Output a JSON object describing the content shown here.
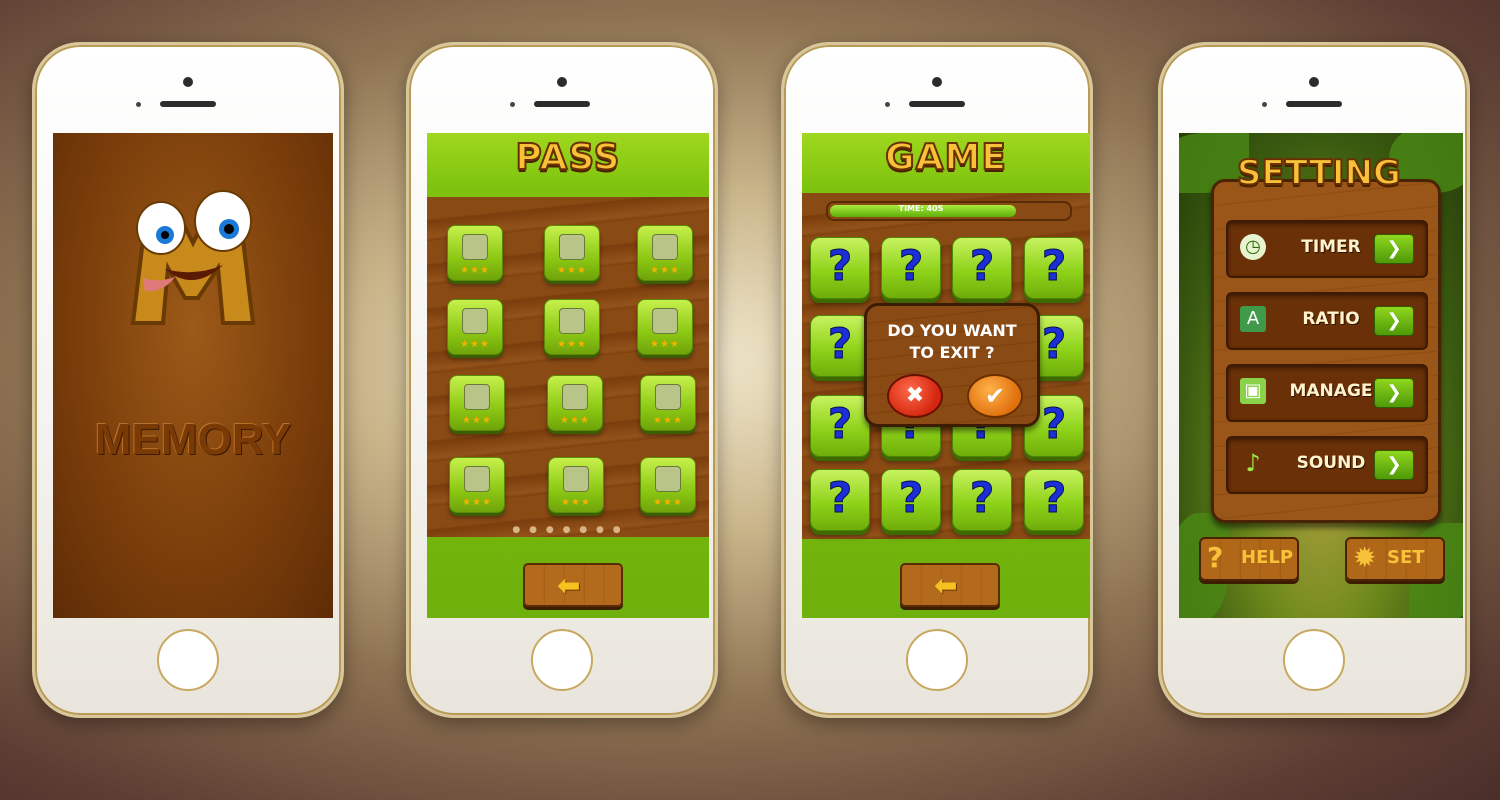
{
  "screen1": {
    "title": "MEMORY"
  },
  "screen2": {
    "title": "PASS",
    "levels": [
      {
        "stars": "★★★"
      },
      {
        "stars": "★★★"
      },
      {
        "stars": "★★★"
      },
      {
        "stars": "★★★"
      },
      {
        "stars": "★★★"
      },
      {
        "stars": "★★★"
      },
      {
        "stars": "★★★"
      },
      {
        "stars": "★★★"
      },
      {
        "stars": "★★★"
      },
      {
        "stars": "★★★"
      },
      {
        "stars": "★★★"
      },
      {
        "stars": "★★★"
      }
    ],
    "page_dots": "● ● ● ● ● ● ●",
    "back_icon": "arrow-left-icon"
  },
  "screen3": {
    "title": "GAME",
    "timer_text": "TIME: 40S",
    "timer_progress": 0.78,
    "tile_glyph": "?",
    "dialog": {
      "line1": "DO YOU WANT",
      "line2": "TO EXIT ?",
      "no": "✖",
      "yes": "✔"
    }
  },
  "screen4": {
    "title": "SETTING",
    "rows": [
      {
        "label": "TIMER",
        "icon": "clock-icon",
        "glyph": "◷",
        "go": "❯"
      },
      {
        "label": "RATIO",
        "icon": "document-icon",
        "glyph": "A",
        "go": "❯"
      },
      {
        "label": "MANAGE",
        "icon": "floppy-icon",
        "glyph": "▣",
        "go": "❯"
      },
      {
        "label": "SOUND",
        "icon": "music-note-icon",
        "glyph": "♪",
        "go": "❯"
      }
    ],
    "help_label": "HELP",
    "help_glyph": "?",
    "set_label": "SET",
    "set_glyph": "✹"
  }
}
